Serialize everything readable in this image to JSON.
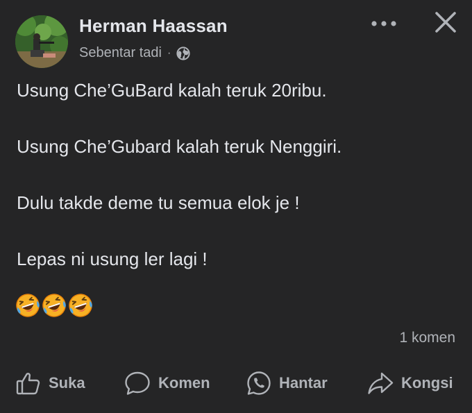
{
  "post": {
    "author": "Herman Haassan",
    "timestamp": "Sebentar tadi",
    "separator": "·",
    "audience_icon": "globe-icon",
    "lines": [
      "Usung Che’GuBard kalah teruk 20ribu.",
      "Usung Che’Gubard kalah teruk Nenggiri.",
      "Dulu takde deme tu semua elok je !",
      "Lepas ni usung ler lagi !"
    ],
    "emoji": [
      "rolling-on-floor-laughing",
      "rolling-on-floor-laughing",
      "rolling-on-floor-laughing"
    ],
    "comment_count": "1 komen"
  },
  "header": {
    "more_icon": "more-dots-icon",
    "close_icon": "close-icon"
  },
  "actions": {
    "like": "Suka",
    "comment": "Komen",
    "send": "Hantar",
    "share": "Kongsi"
  },
  "colors": {
    "background": "#252526",
    "text_primary": "#e4e6eb",
    "text_secondary": "#b0b3b8",
    "emoji_yellow": "#f7b125",
    "emoji_orange": "#e8830a"
  }
}
